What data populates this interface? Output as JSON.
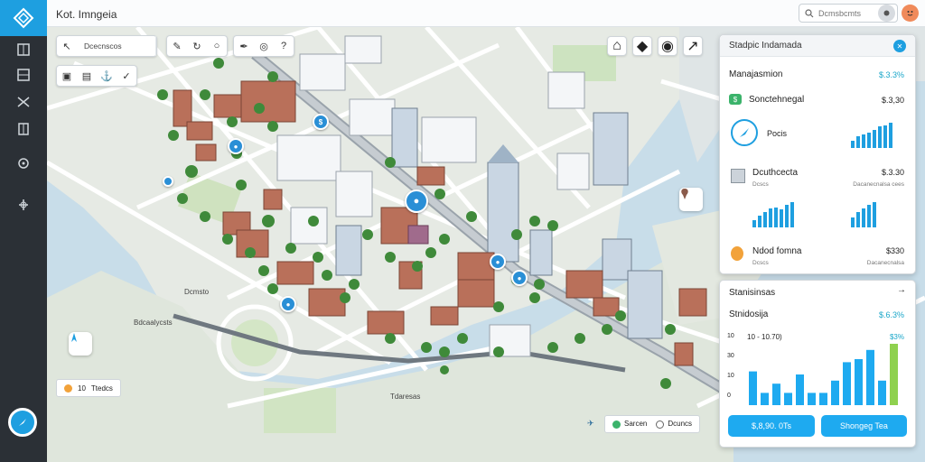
{
  "app": {
    "title": "Kot. Imngeia",
    "search_placeholder": "Dcmsbcmts"
  },
  "map_toolbar": {
    "coords": "Dcecnscos"
  },
  "labels": {
    "area1": "Dcmsto",
    "area2": "Bdcaalycsts",
    "area3": "Tdaresas"
  },
  "scale_chip": {
    "value": "10",
    "text": "Ttedcs"
  },
  "legend": {
    "item1": "Sarcen",
    "item2": "Dcuncs",
    "color1": "#3bb36b",
    "color2": "#ffffff"
  },
  "panel1": {
    "title": "Stadpic Indamada",
    "r1": {
      "label": "Manajasmion",
      "value": "$.3.3%"
    },
    "r2": {
      "label": "Sonctehnegal",
      "value": "$.3,30"
    },
    "r3": {
      "label": "Pocis"
    },
    "r4": {
      "label": "Dcuthcecta",
      "value": "$.3.30",
      "sub1": "Dcscs",
      "sub2": "Dacanecnalsa cees"
    },
    "r5": {
      "label": "Ndod fomna",
      "value": "$330",
      "sub1": "Dcscs",
      "sub2": "Dacanecnalsa"
    },
    "spark1": [
      0.3,
      0.45,
      0.55,
      0.6,
      0.7,
      0.85,
      0.9,
      1.0
    ],
    "spark2": [
      0.3,
      0.45,
      0.6,
      0.75,
      0.8,
      0.7,
      0.9,
      1.0
    ],
    "spark3": [
      0.4,
      0.6,
      0.75,
      0.9,
      1.0
    ],
    "spark4": [
      0.35,
      0.55,
      0.45,
      0.7,
      0.55,
      0.85,
      0.8,
      1.0
    ]
  },
  "panel2": {
    "title": "Stanisinsas",
    "subtitle": "Stnidosija",
    "pct": "$.6.3%",
    "range_label": "10 - 10.70)",
    "pct2": "$3%",
    "btn1": "$,8,90. 0Ts",
    "btn2": "Shongeg Tea"
  },
  "chart_data": {
    "type": "bar",
    "y_ticks": [
      "10",
      "30",
      "10",
      "0"
    ],
    "values": [
      0.55,
      0.2,
      0.35,
      0.2,
      0.5,
      0.2,
      0.2,
      0.4,
      0.7,
      0.75,
      0.9,
      0.4,
      1.0
    ],
    "colors": [
      "#1eaaf0",
      "#1eaaf0",
      "#1eaaf0",
      "#1eaaf0",
      "#1eaaf0",
      "#1eaaf0",
      "#1eaaf0",
      "#1eaaf0",
      "#1eaaf0",
      "#1eaaf0",
      "#1eaaf0",
      "#1eaaf0",
      "#8fd14f"
    ]
  }
}
